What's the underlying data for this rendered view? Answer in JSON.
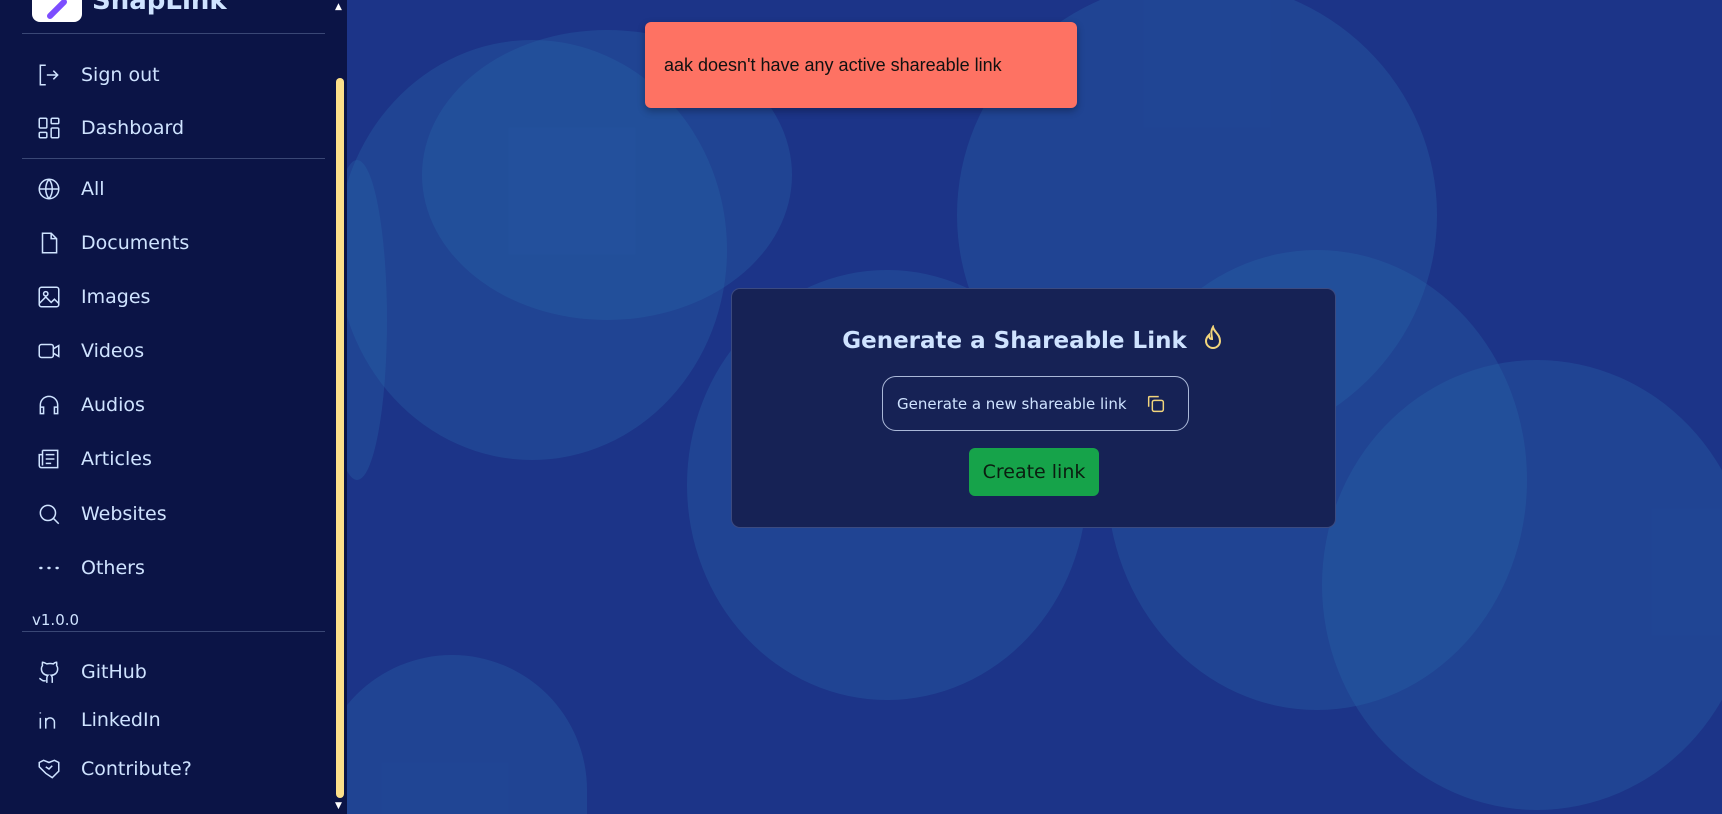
{
  "app": {
    "name": "SnapLink",
    "version": "v1.0.0"
  },
  "sidebar": {
    "items": [
      {
        "label": "Sign out",
        "icon": "sign-out-icon"
      },
      {
        "label": "Dashboard",
        "icon": "dashboard-icon"
      },
      {
        "label": "All",
        "icon": "globe-icon"
      },
      {
        "label": "Documents",
        "icon": "document-icon"
      },
      {
        "label": "Images",
        "icon": "image-icon"
      },
      {
        "label": "Videos",
        "icon": "video-icon"
      },
      {
        "label": "Audios",
        "icon": "headphones-icon"
      },
      {
        "label": "Articles",
        "icon": "newspaper-icon"
      },
      {
        "label": "Websites",
        "icon": "search-icon"
      },
      {
        "label": "Others",
        "icon": "ellipsis-icon"
      }
    ],
    "footer": [
      {
        "label": "GitHub",
        "icon": "github-icon"
      },
      {
        "label": "LinkedIn",
        "icon": "linkedin-icon"
      },
      {
        "label": "Contribute?",
        "icon": "handshake-icon"
      }
    ]
  },
  "toast": {
    "message": "aak doesn't have any active shareable link",
    "color": "#fe7263"
  },
  "card": {
    "title": "Generate a Shareable Link",
    "title_icon": "flame-icon",
    "input_text": "Generate a new shareable link",
    "copy_icon": "copy-icon",
    "button": "Create link",
    "button_color": "#16a34a"
  }
}
